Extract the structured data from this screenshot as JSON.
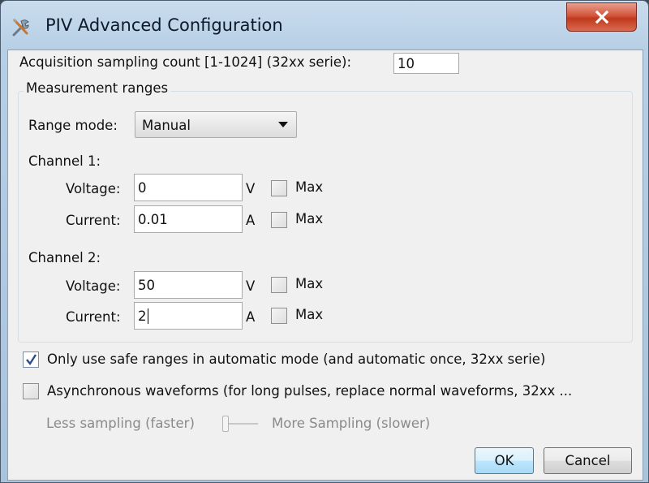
{
  "window": {
    "title": "PIV Advanced Configuration",
    "title_icon": "tools-icon",
    "close_label": "X"
  },
  "acquisition": {
    "label": "Acquisition sampling count [1-1024] (32xx serie):",
    "value": "10"
  },
  "measurement_ranges": {
    "title": "Measurement ranges",
    "range_mode_label": "Range mode:",
    "range_mode_value": "Manual",
    "channels": [
      {
        "label": "Channel 1:",
        "voltage": {
          "label": "Voltage:",
          "value": "0",
          "unit": "V",
          "max_label": "Max",
          "max_checked": false
        },
        "current": {
          "label": "Current:",
          "value": "0.01",
          "unit": "A",
          "max_label": "Max",
          "max_checked": false
        }
      },
      {
        "label": "Channel 2:",
        "voltage": {
          "label": "Voltage:",
          "value": "50",
          "unit": "V",
          "max_label": "Max",
          "max_checked": false
        },
        "current": {
          "label": "Current:",
          "value": "2",
          "unit": "A",
          "max_label": "Max",
          "max_checked": false
        }
      }
    ]
  },
  "options": {
    "safe_ranges_label": "Only use safe ranges in automatic mode (and automatic once, 32xx serie)",
    "safe_ranges_checked": true,
    "async_label": "Asynchronous waveforms (for long pulses, replace normal waveforms, 32xx ...",
    "async_checked": false
  },
  "sampling": {
    "less_label": "Less sampling (faster)",
    "more_label": "More Sampling (slower)",
    "level": 0
  },
  "buttons": {
    "ok": "OK",
    "cancel": "Cancel"
  },
  "colors": {
    "title_gradient_top": "#c9dced",
    "close_button": "#c0391d",
    "client_bg": "#f0f0f0",
    "disabled_text": "#8a8a8a"
  }
}
